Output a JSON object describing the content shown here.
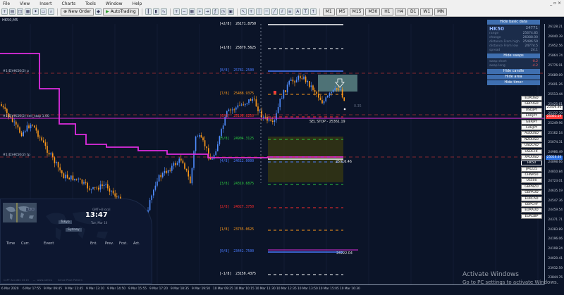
{
  "menu": [
    "File",
    "View",
    "Insert",
    "Charts",
    "Tools",
    "Window",
    "Help"
  ],
  "window_controls": "_ ▫ ×",
  "toolbar": {
    "new_order": "New Order",
    "autotrading": "AutoTrading",
    "period_buttons": [
      "M1",
      "M5",
      "M15",
      "M30",
      "H1",
      "H4",
      "D1",
      "W1",
      "MN"
    ]
  },
  "chart_tab": "HK50,M5",
  "indicator_labels": {
    "line1": "#1(D)HK50(2) p",
    "line2": "#1(D)HK50(2) sell_stop 1.00",
    "line3": "#1(D)HK50(2) tp"
  },
  "levels": [
    {
      "label": "[+2/8]  26171.8750",
      "color": "#ffffff"
    },
    {
      "label": "[+1/8]  25879.5625",
      "color": "#ffffff"
    },
    {
      "label": "[8/8]  25781.2500",
      "color": "#4a7bff"
    },
    {
      "label": "[7/8]  25488.9375",
      "color": "#ff9a1a"
    },
    {
      "label": "[6/8]  25196.6250",
      "color": "#ff2a2a"
    },
    {
      "label": "[5/8]  24904.3125",
      "color": "#2ecc40"
    },
    {
      "label": "[4/8]  24612.0000",
      "color": "#4a7bff"
    },
    {
      "label": "[3/8]  24319.6875",
      "color": "#2ecc40"
    },
    {
      "label": "[2/8]  24027.3750",
      "color": "#ff2a2a"
    },
    {
      "label": "[1/8]  23735.0625",
      "color": "#ff9a1a"
    },
    {
      "label": "[0/8]  23442.7500",
      "color": "#4a7bff"
    },
    {
      "label": "[-1/8]  23150.4375",
      "color": "#ffffff"
    }
  ],
  "order_labels": {
    "sell_stop": "SEL STOP - 25361.19",
    "tp_price": "25016.46",
    "low_price": "24222.04",
    "arrow_label": "0.35"
  },
  "info_panel": {
    "hide_basic": "Hide basic data",
    "symbol": "HK50",
    "symbol_value": "24771",
    "rows": [
      {
        "k": "range",
        "v": "25674.85"
      },
      {
        "k": "change",
        "v": "26088.00"
      },
      {
        "k": "distance From high",
        "v": "25486.59"
      },
      {
        "k": "distance From low",
        "v": "24774.5"
      },
      {
        "k": "spread",
        "v": "24.1"
      }
    ],
    "hide_swaps": "Hide swaps",
    "swap_rows": [
      {
        "k": "swap short",
        "v": "-0.2"
      },
      {
        "k": "swap long",
        "v": "-4.2"
      }
    ],
    "hide_candle": "Hide candle",
    "hide_area": "Hide area",
    "hide_timer": "Hide timer"
  },
  "symbols": [
    "EURUSD",
    "GBPUSD",
    "USDJPY",
    "EURJPY",
    "GBPJPY",
    "CADJPY",
    "AUDUSD",
    "NZDUSD",
    "USDCAD",
    "USDCHF",
    "XAUUSD",
    "HK50",
    "JPX225",
    "CHNA50",
    "US500",
    "GBPNZD",
    "GBPAUD",
    "EURCAD",
    "GBPCHF",
    "EURAUD",
    "EURGBP"
  ],
  "active_symbol": "HK50",
  "price_axis": {
    "labels": [
      "26128.21",
      "26040.39",
      "25952.56",
      "25864.74",
      "25776.91",
      "25689.09",
      "25601.26",
      "25513.44",
      "25425.61",
      "25337.79",
      "25249.96",
      "25162.14",
      "25074.31",
      "24986.49",
      "24898.66",
      "24810.84",
      "24723.01",
      "24635.19",
      "24547.36",
      "24459.54",
      "24371.71",
      "24283.89",
      "24196.06",
      "24108.24",
      "24020.41",
      "23932.59",
      "23844.76"
    ],
    "current_price": "25406.80",
    "tag_sell": "25361.19",
    "tag_tp": "25016.46"
  },
  "time_axis": [
    "6 Mar 2020",
    "6 Mar 17:55",
    "9 Mar 09:45",
    "9 Mar 11:45",
    "9 Mar 13:10",
    "9 Mar 14:50",
    "9 Mar 15:55",
    "9 Mar 17:20",
    "9 Mar 18:35",
    "9 Mar 19:50",
    "10 Mar 09:25",
    "10 Mar 10:15",
    "10 Mar 11:30",
    "10 Mar 12:35",
    "10 Mar 13:50",
    "10 Mar 15:05",
    "10 Mar 16:30"
  ],
  "clock": {
    "time": "13:47",
    "date": "Tue, Mar 10",
    "subtitle": "GMT+8 local",
    "markets": [
      "Tokyo",
      "Sydney"
    ],
    "sessions": [
      "Time",
      "Curr.",
      "Event",
      "Ent.",
      "Prev.",
      "Fcst.",
      "Act."
    ],
    "footer": "CxPT AccuWx 13:15     —  www.calf.eu       Sense Pivot Pattern"
  },
  "watermark": {
    "title": "Activate Windows",
    "subtitle": "Go to PC settings to activate Windows."
  }
}
